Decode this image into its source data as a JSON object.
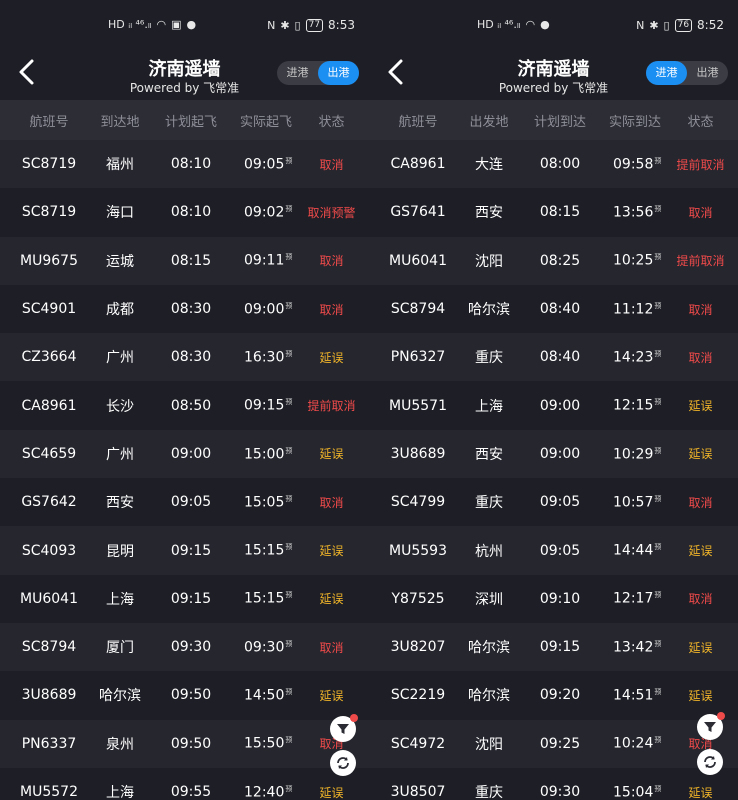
{
  "left": {
    "status_bar": {
      "left_text": "HD ᵢₗ ⁴⁶.ₗₗ",
      "time": "8:53",
      "battery": "77"
    },
    "header": {
      "title": "济南遥墙",
      "subtitle": "Powered by 飞常准",
      "toggle_in": "进港",
      "toggle_out": "出港",
      "active": "out"
    },
    "columns": [
      "航班号",
      "到达地",
      "计划起飞",
      "实际起飞",
      "状态"
    ],
    "est_mark": "预",
    "rows": [
      {
        "flight": "SC8719",
        "place": "福州",
        "plan": "08:10",
        "actual": "09:05",
        "status": "取消",
        "type": "cancel"
      },
      {
        "flight": "SC8719",
        "place": "海口",
        "plan": "08:10",
        "actual": "09:02",
        "status": "取消预警",
        "type": "cancel"
      },
      {
        "flight": "MU9675",
        "place": "运城",
        "plan": "08:15",
        "actual": "09:11",
        "status": "取消",
        "type": "cancel"
      },
      {
        "flight": "SC4901",
        "place": "成都",
        "plan": "08:30",
        "actual": "09:00",
        "status": "取消",
        "type": "cancel"
      },
      {
        "flight": "CZ3664",
        "place": "广州",
        "plan": "08:30",
        "actual": "16:30",
        "status": "延误",
        "type": "delay"
      },
      {
        "flight": "CA8961",
        "place": "长沙",
        "plan": "08:50",
        "actual": "09:15",
        "status": "提前取消",
        "type": "cancel"
      },
      {
        "flight": "SC4659",
        "place": "广州",
        "plan": "09:00",
        "actual": "15:00",
        "status": "延误",
        "type": "delay"
      },
      {
        "flight": "GS7642",
        "place": "西安",
        "plan": "09:05",
        "actual": "15:05",
        "status": "取消",
        "type": "cancel"
      },
      {
        "flight": "SC4093",
        "place": "昆明",
        "plan": "09:15",
        "actual": "15:15",
        "status": "延误",
        "type": "delay"
      },
      {
        "flight": "MU6041",
        "place": "上海",
        "plan": "09:15",
        "actual": "15:15",
        "status": "延误",
        "type": "delay"
      },
      {
        "flight": "SC8794",
        "place": "厦门",
        "plan": "09:30",
        "actual": "09:30",
        "status": "取消",
        "type": "cancel"
      },
      {
        "flight": "3U8689",
        "place": "哈尔滨",
        "plan": "09:50",
        "actual": "14:50",
        "status": "延误",
        "type": "delay"
      },
      {
        "flight": "PN6337",
        "place": "泉州",
        "plan": "09:50",
        "actual": "15:50",
        "status": "取消",
        "type": "cancel"
      },
      {
        "flight": "MU5572",
        "place": "上海",
        "plan": "09:55",
        "actual": "12:40",
        "status": "延误",
        "type": "delay"
      }
    ]
  },
  "right": {
    "status_bar": {
      "left_text": "HD ᵢₗ ⁴⁶.ₗₗ",
      "time": "8:52",
      "battery": "76"
    },
    "header": {
      "title": "济南遥墙",
      "subtitle": "Powered by 飞常准",
      "toggle_in": "进港",
      "toggle_out": "出港",
      "active": "in"
    },
    "columns": [
      "航班号",
      "出发地",
      "计划到达",
      "实际到达",
      "状态"
    ],
    "est_mark": "预",
    "rows": [
      {
        "flight": "CA8961",
        "place": "大连",
        "plan": "08:00",
        "actual": "09:58",
        "status": "提前取消",
        "type": "cancel"
      },
      {
        "flight": "GS7641",
        "place": "西安",
        "plan": "08:15",
        "actual": "13:56",
        "status": "取消",
        "type": "cancel"
      },
      {
        "flight": "MU6041",
        "place": "沈阳",
        "plan": "08:25",
        "actual": "10:25",
        "status": "提前取消",
        "type": "cancel"
      },
      {
        "flight": "SC8794",
        "place": "哈尔滨",
        "plan": "08:40",
        "actual": "11:12",
        "status": "取消",
        "type": "cancel"
      },
      {
        "flight": "PN6327",
        "place": "重庆",
        "plan": "08:40",
        "actual": "14:23",
        "status": "取消",
        "type": "cancel"
      },
      {
        "flight": "MU5571",
        "place": "上海",
        "plan": "09:00",
        "actual": "12:15",
        "status": "延误",
        "type": "delay"
      },
      {
        "flight": "3U8689",
        "place": "西安",
        "plan": "09:00",
        "actual": "10:29",
        "status": "延误",
        "type": "delay"
      },
      {
        "flight": "SC4799",
        "place": "重庆",
        "plan": "09:05",
        "actual": "10:57",
        "status": "取消",
        "type": "cancel"
      },
      {
        "flight": "MU5593",
        "place": "杭州",
        "plan": "09:05",
        "actual": "14:44",
        "status": "延误",
        "type": "delay"
      },
      {
        "flight": "Y87525",
        "place": "深圳",
        "plan": "09:10",
        "actual": "12:17",
        "status": "取消",
        "type": "cancel"
      },
      {
        "flight": "3U8207",
        "place": "哈尔滨",
        "plan": "09:15",
        "actual": "13:42",
        "status": "延误",
        "type": "delay"
      },
      {
        "flight": "SC2219",
        "place": "哈尔滨",
        "plan": "09:20",
        "actual": "14:51",
        "status": "延误",
        "type": "delay"
      },
      {
        "flight": "SC4972",
        "place": "沈阳",
        "plan": "09:25",
        "actual": "10:24",
        "status": "取消",
        "type": "cancel"
      },
      {
        "flight": "3U8507",
        "place": "重庆",
        "plan": "09:30",
        "actual": "15:04",
        "status": "延误",
        "type": "delay"
      }
    ]
  },
  "colors": {
    "accent": "#1c8ff2",
    "cancel": "#ef4a4a",
    "delay": "#f0b429",
    "background": "#1e1f26",
    "alt_row": "#25262e",
    "header_row": "#2c2d35"
  },
  "icons": {
    "back": "chevron-left-icon",
    "filter": "filter-icon",
    "refresh": "refresh-icon"
  }
}
